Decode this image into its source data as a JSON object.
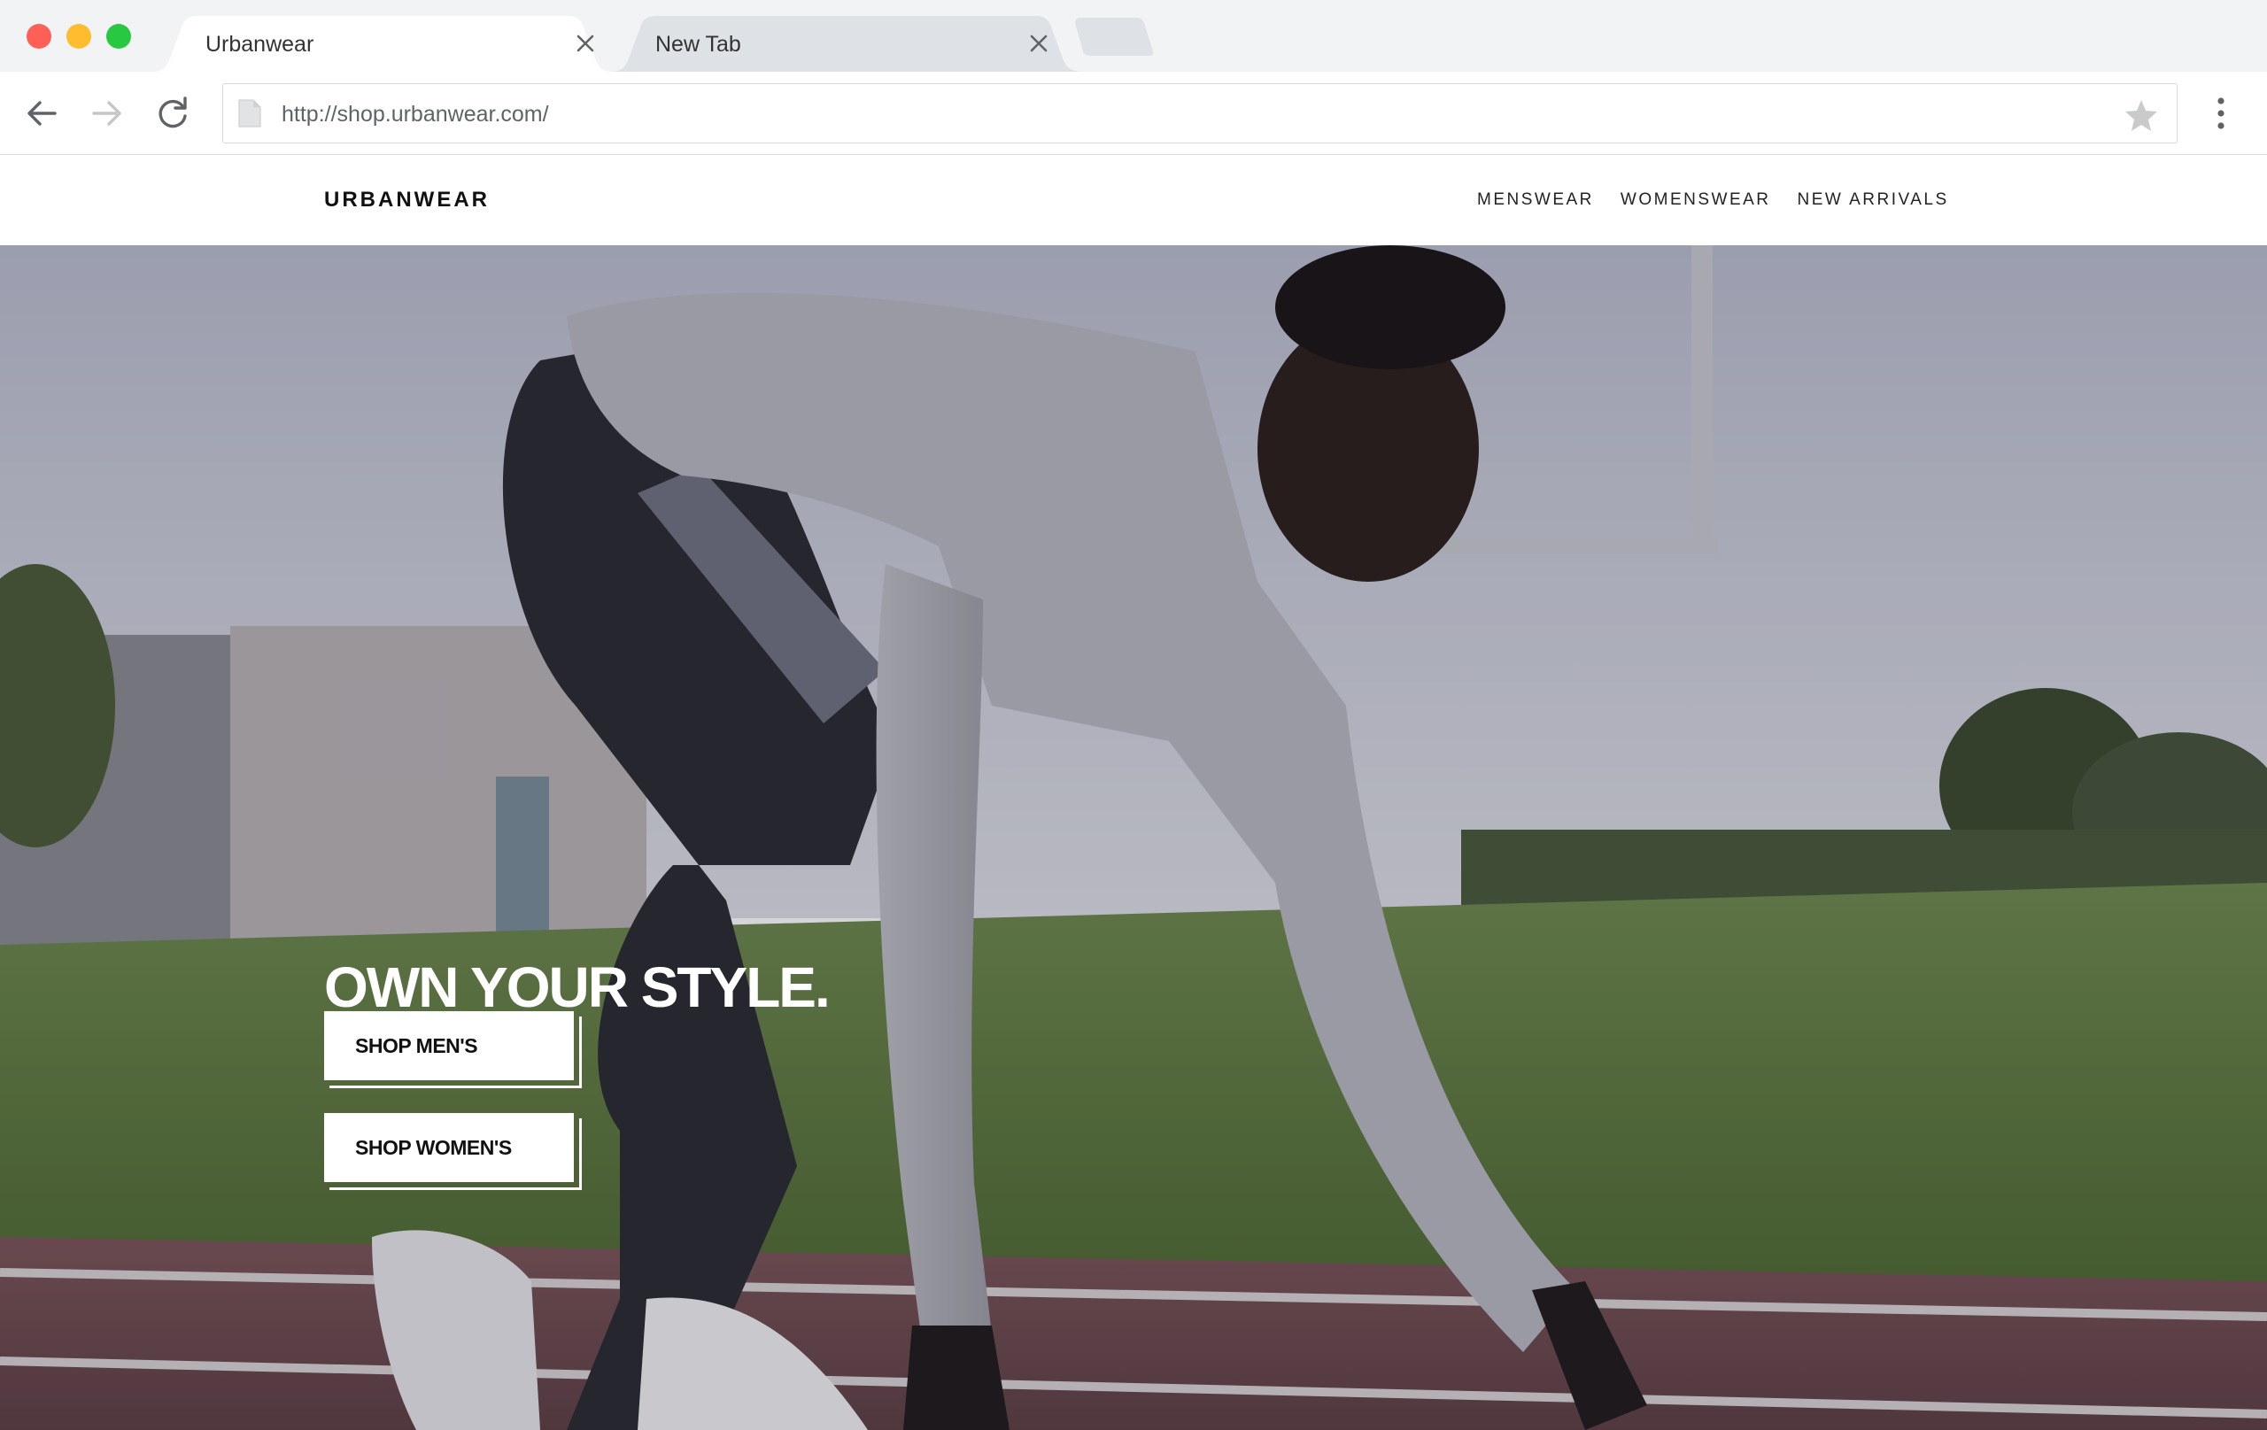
{
  "browser": {
    "tabs": [
      {
        "title": "Urbanwear",
        "active": true
      },
      {
        "title": "New Tab",
        "active": false
      }
    ],
    "url": "http://shop.urbanwear.com/",
    "icons": {
      "back": "arrow-left-icon",
      "forward": "arrow-right-icon",
      "reload": "reload-icon",
      "page": "page-icon",
      "bookmark": "star-icon",
      "menu": "kebab-menu-icon",
      "close": "close-icon"
    }
  },
  "site": {
    "brand": "URBANWEAR",
    "nav": [
      {
        "label": "MENSWEAR"
      },
      {
        "label": "WOMENSWEAR"
      },
      {
        "label": "NEW ARRIVALS"
      }
    ]
  },
  "hero": {
    "headline": "OWN YOUR STYLE.",
    "buttons": [
      {
        "label": "SHOP MEN'S"
      },
      {
        "label": "SHOP WOMEN'S"
      }
    ],
    "image": "sprinter-in-starting-position-photo"
  },
  "colors": {
    "traffic_red": "#fe5f57",
    "traffic_yellow": "#febc2e",
    "traffic_green": "#28c840",
    "chrome_bg": "#f1f3f4",
    "text_dark": "#111111"
  }
}
